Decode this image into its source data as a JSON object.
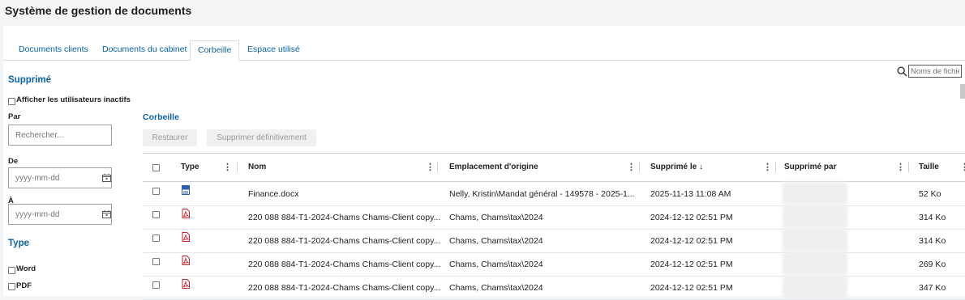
{
  "app": {
    "title": "Système de gestion de documents"
  },
  "tabs": [
    {
      "label": "Documents clients"
    },
    {
      "label": "Documents du cabinet"
    },
    {
      "label": "Corbeille"
    },
    {
      "label": "Espace utilisé"
    }
  ],
  "active_tab": "Corbeille",
  "search": {
    "placeholder": "Noms de fichie"
  },
  "filters": {
    "deleted_title": "Supprimé",
    "show_inactive_label": "Afficher les utilisateurs inactifs",
    "by_label": "Par",
    "by_placeholder": "Rechercher...",
    "from_label": "De",
    "from_placeholder": "yyyy-mm-dd",
    "to_label": "À",
    "to_placeholder": "yyyy-mm-dd",
    "type_title": "Type",
    "type_options": [
      {
        "label": "Word"
      },
      {
        "label": "PDF"
      }
    ]
  },
  "main": {
    "section_title": "Corbeille",
    "restore_label": "Restaurer",
    "delete_perm_label": "Supprimer définitivement"
  },
  "table": {
    "columns": {
      "type": "Type",
      "name": "Nom",
      "location": "Emplacement d'origine",
      "deleted_on": "Supprimé le",
      "sort_arrow": "↓",
      "deleted_by": "Supprimé par",
      "size": "Taille"
    },
    "rows": [
      {
        "file_type": "word",
        "name": "Finance.docx",
        "location": "Nelly, Kristin\\Mandat général - 149578 - 2025-1...",
        "deleted_on": "2025-11-13 11:08 AM",
        "size": "52 Ko"
      },
      {
        "file_type": "pdf",
        "name": "220 088 884-T1-2024-Chams Chams-Client copy...",
        "location": "Chams, Chams\\tax\\2024",
        "deleted_on": "2024-12-12 02:51 PM",
        "size": "314 Ko"
      },
      {
        "file_type": "pdf",
        "name": "220 088 884-T1-2024-Chams Chams-Client copy...",
        "location": "Chams, Chams\\tax\\2024",
        "deleted_on": "2024-12-12 02:51 PM",
        "size": "314 Ko"
      },
      {
        "file_type": "pdf",
        "name": "220 088 884-T1-2024-Chams Chams-Client copy...",
        "location": "Chams, Chams\\tax\\2024",
        "deleted_on": "2024-12-12 02:51 PM",
        "size": "269 Ko"
      },
      {
        "file_type": "pdf",
        "name": "220 088 884-T1-2024-Chams Chams-Client copy...",
        "location": "Chams, Chams\\tax\\2024",
        "deleted_on": "2024-12-12 02:51 PM",
        "size": "347 Ko"
      }
    ]
  },
  "colors": {
    "accent": "#0a62a8",
    "pdf": "#c8202b",
    "word": "#2b5fb3"
  }
}
